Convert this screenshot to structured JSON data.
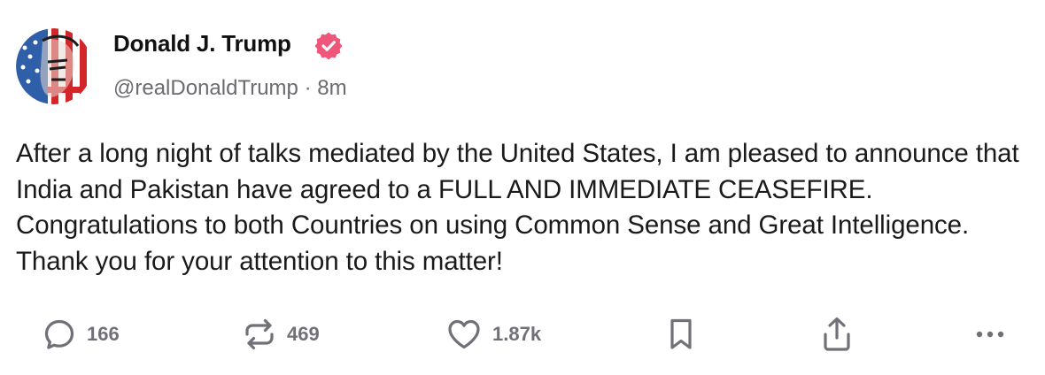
{
  "post": {
    "author": {
      "display_name": "Donald J. Trump",
      "handle": "@realDonaldTrump",
      "separator": "·",
      "time_ago": "8m",
      "verified": true,
      "verified_badge_color": "#f0557a"
    },
    "text": "After a long night of talks mediated by the United States, I am pleased to announce that India and Pakistan have agreed to a FULL AND IMMEDIATE CEASEFIRE. Congratulations to both Countries on using Common Sense and Great Intelligence. Thank you for your attention to this matter!",
    "actions": {
      "reply": {
        "icon": "reply-bubble-icon",
        "count": "166"
      },
      "repost": {
        "icon": "repost-arrows-icon",
        "count": "469"
      },
      "like": {
        "icon": "heart-icon",
        "count": "1.87k"
      },
      "bookmark": {
        "icon": "bookmark-icon"
      },
      "share": {
        "icon": "share-upload-icon"
      },
      "more": {
        "icon": "more-dots-icon"
      }
    },
    "colors": {
      "text": "#1a1a1a",
      "muted": "#6b6b70",
      "icon": "#707078"
    }
  }
}
